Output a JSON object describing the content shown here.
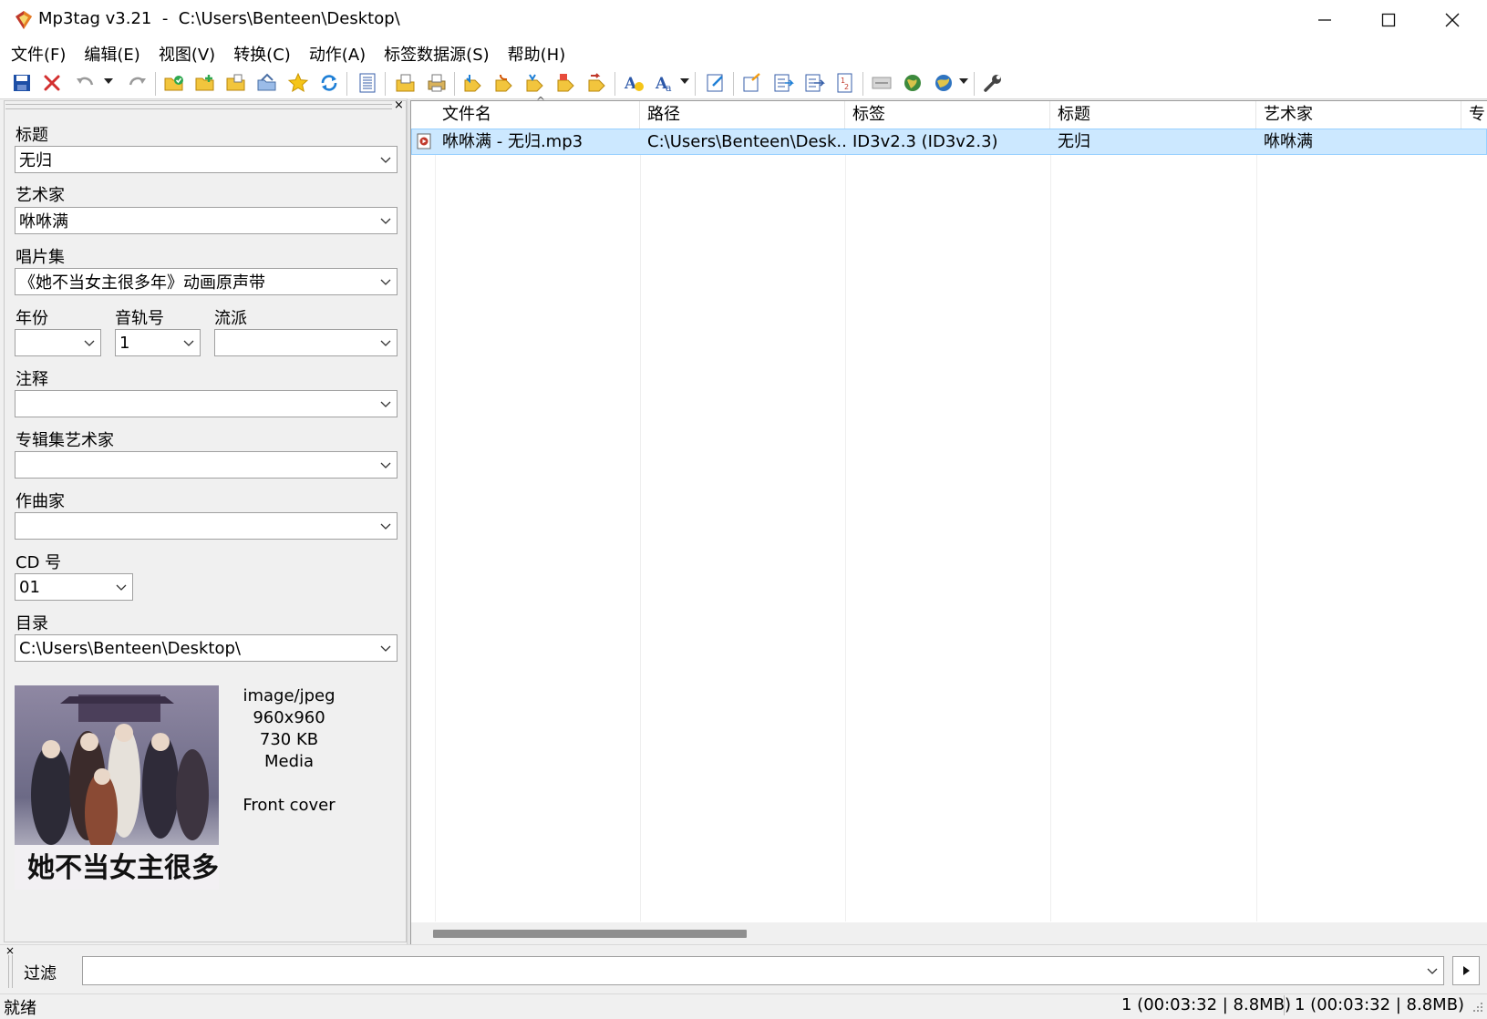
{
  "window": {
    "title": "Mp3tag v3.21  -  C:\\Users\\Benteen\\Desktop\\"
  },
  "menu": [
    "文件(F)",
    "编辑(E)",
    "视图(V)",
    "转换(C)",
    "动作(A)",
    "标签数据源(S)",
    "帮助(H)"
  ],
  "toolbar_icons": [
    "save-icon",
    "remove-tag-icon",
    "undo-icon",
    "undo-dropdown-icon",
    "redo-icon",
    "change-directory-icon",
    "add-directory-icon",
    "open-folder-icon",
    "favorite-folder-icon",
    "favorites-star-icon",
    "refresh-icon",
    "extended-tags-icon",
    "export-icon",
    "print-icon",
    "tag-filename-icon",
    "filename-tag-icon",
    "text-file-tag-icon",
    "tag-tag-icon",
    "rename-icon",
    "case-conversion-icon",
    "actions-icon",
    "actions-dropdown-icon",
    "edit-playlist-icon",
    "playlist-icon",
    "move-icon",
    "copy-icon",
    "sequence-icon",
    "discogs-icon",
    "web-source-icon",
    "web-source-2-icon",
    "web-source-dropdown-icon",
    "options-wrench-icon"
  ],
  "tag_panel": {
    "title_label": "标题",
    "title_value": "无归",
    "artist_label": "艺术家",
    "artist_value": "咻咻满",
    "album_label": "唱片集",
    "album_value": "《她不当女主很多年》动画原声带",
    "year_label": "年份",
    "year_value": "",
    "track_label": "音轨号",
    "track_value": "1",
    "genre_label": "流派",
    "genre_value": "",
    "comment_label": "注释",
    "comment_value": "",
    "album_artist_label": "专辑集艺术家",
    "album_artist_value": "",
    "composer_label": "作曲家",
    "composer_value": "",
    "disc_label": "CD 号",
    "disc_value": "01",
    "directory_label": "目录",
    "directory_value": "C:\\Users\\Benteen\\Desktop\\",
    "cover": {
      "mime": "image/jpeg",
      "dimensions": "960x960",
      "size": "730 KB",
      "type": "Media",
      "description": "Front cover",
      "title_text": "她不当女主很多年"
    }
  },
  "file_list": {
    "columns": [
      "文件名",
      "路径",
      "标签",
      "标题",
      "艺术家",
      "专"
    ],
    "rows": [
      {
        "filename": "咻咻满 - 无归.mp3",
        "path": "C:\\Users\\Benteen\\Desk...",
        "tag": "ID3v2.3 (ID3v2.3)",
        "title": "无归",
        "artist": "咻咻满"
      }
    ],
    "selected_row": 0
  },
  "filter": {
    "label": "过滤",
    "value": ""
  },
  "status": {
    "left": "就绪",
    "selected": "1 (00:03:32 | 8.8MB)",
    "total": "1 (00:03:32 | 8.8MB)"
  },
  "colors": {
    "selection_bg": "#cce8ff",
    "selection_border": "#99d1ff",
    "window_bg": "#f0f0f0"
  }
}
